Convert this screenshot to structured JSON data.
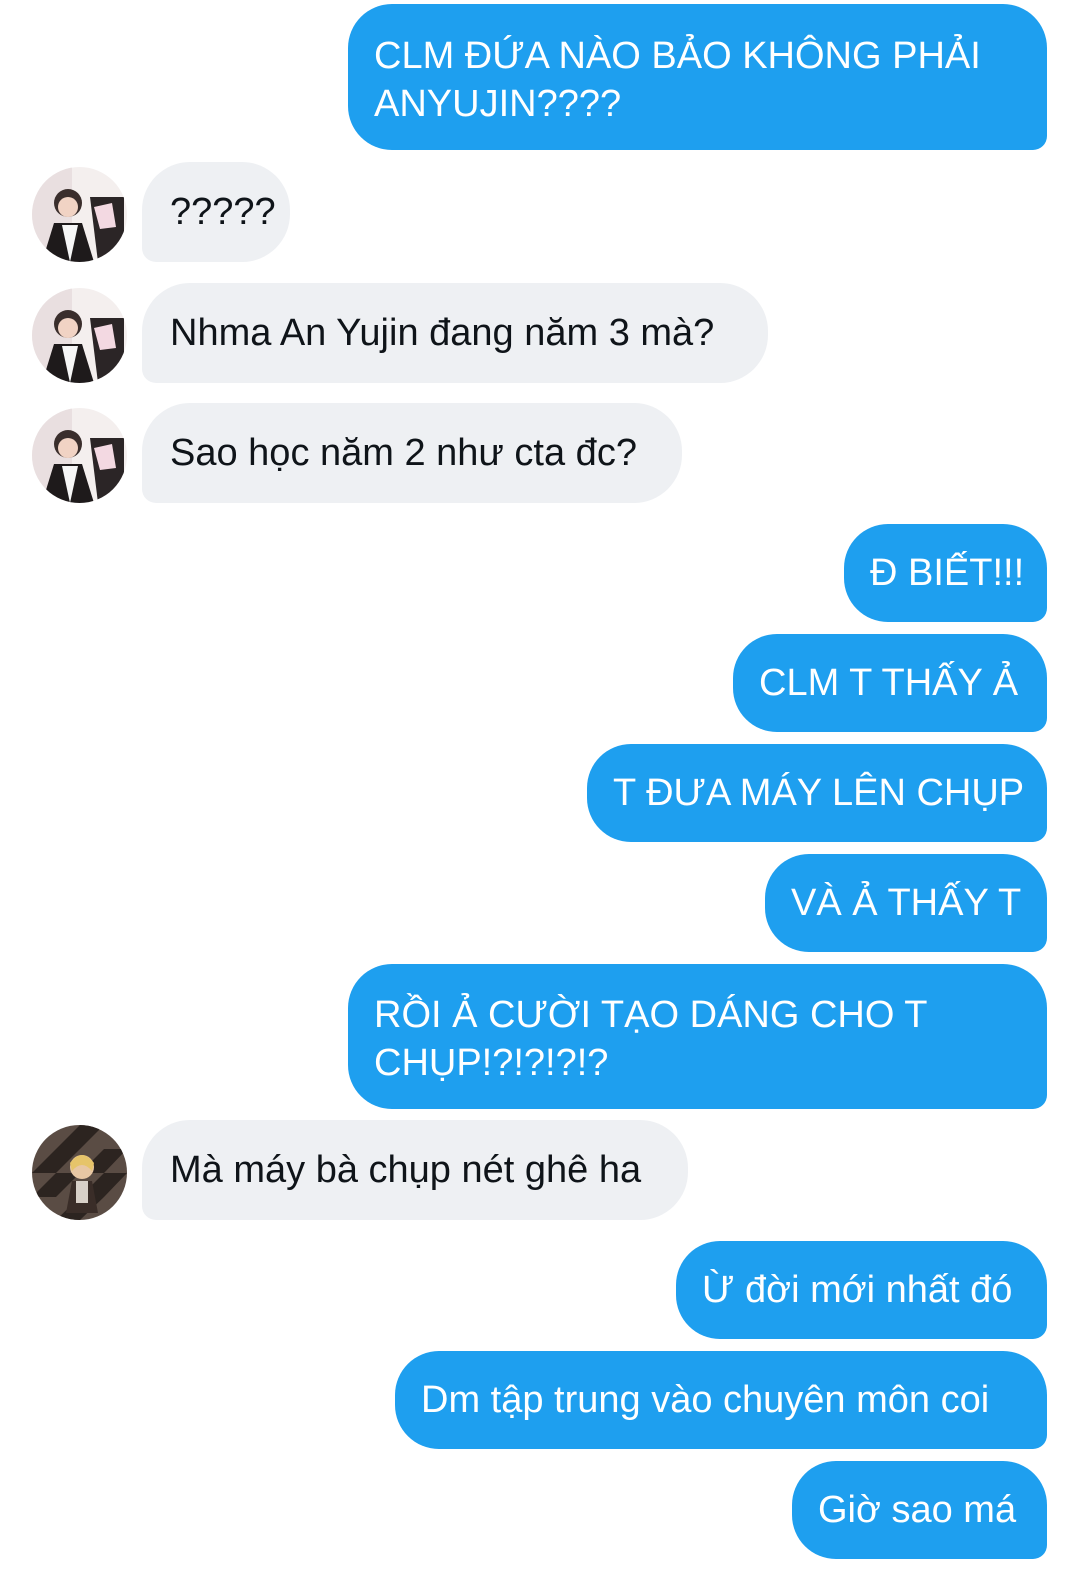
{
  "conversation": {
    "messages": [
      {
        "id": "m1",
        "sender": "me",
        "text": "CLM ĐỨA NÀO BẢO KHÔNG PHẢI\nANYUJIN????"
      },
      {
        "id": "m2",
        "sender": "them",
        "avatar": "profile-avatar-a",
        "text": "?????"
      },
      {
        "id": "m3",
        "sender": "them",
        "avatar": "profile-avatar-a",
        "text": "Nhma An Yujin đang năm 3 mà?"
      },
      {
        "id": "m4",
        "sender": "them",
        "avatar": "profile-avatar-a",
        "text": "Sao học năm 2 như cta đc?"
      },
      {
        "id": "m5",
        "sender": "me",
        "text": "Đ BIẾT!!!"
      },
      {
        "id": "m6",
        "sender": "me",
        "text": "CLM T THẤY Ả"
      },
      {
        "id": "m7",
        "sender": "me",
        "text": "T ĐƯA MÁY LÊN CHỤP"
      },
      {
        "id": "m8",
        "sender": "me",
        "text": "VÀ Ả THẤY T"
      },
      {
        "id": "m9",
        "sender": "me",
        "text": "RỒI Ả CƯỜI TẠO DÁNG CHO T\nCHỤP!?!?!?!?"
      },
      {
        "id": "m10",
        "sender": "them",
        "avatar": "profile-avatar-b",
        "text": "Mà máy bà chụp nét ghê ha"
      },
      {
        "id": "m11",
        "sender": "me",
        "text": "Ừ đời mới nhất đó"
      },
      {
        "id": "m12",
        "sender": "me",
        "text": "Dm tập trung vào chuyên môn coi"
      },
      {
        "id": "m13",
        "sender": "me",
        "text": "Giờ sao má"
      }
    ]
  },
  "colors": {
    "outgoing_bubble": "#1e9fef",
    "incoming_bubble": "#eef0f3",
    "incoming_text": "#0f1419",
    "outgoing_text": "#ffffff"
  }
}
